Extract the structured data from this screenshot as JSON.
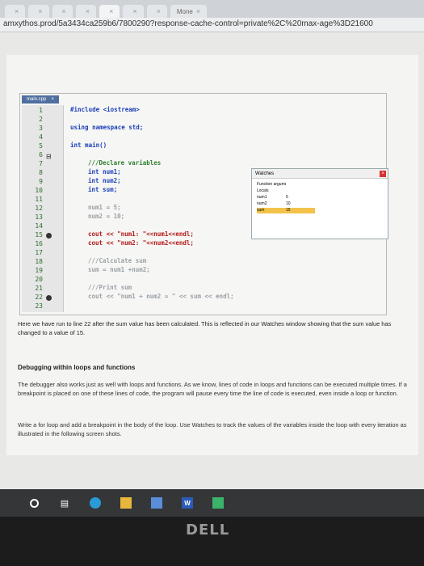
{
  "browser": {
    "tabs": [
      {
        "label": "",
        "active": false
      },
      {
        "label": "",
        "active": false
      },
      {
        "label": "",
        "active": false
      },
      {
        "label": "",
        "active": false
      },
      {
        "label": "",
        "active": true
      },
      {
        "label": "",
        "active": false
      },
      {
        "label": "",
        "active": false
      },
      {
        "label": "Mone",
        "active": false
      }
    ],
    "url": "amxythos.prod/5a3434ca259b6/7800290?response-cache-control=private%2C%20max-age%3D21600"
  },
  "ide": {
    "tab_label": "main.cpp",
    "lines": [
      "1",
      "2",
      "3",
      "4",
      "5",
      "6",
      "7",
      "8",
      "9",
      "10",
      "11",
      "12",
      "13",
      "14",
      "15",
      "16",
      "17",
      "18",
      "19",
      "20",
      "21",
      "22",
      "23"
    ],
    "code": {
      "l1": "#include <iostream>",
      "l3": "using namespace std;",
      "l5": "int main()",
      "l7": "///Declare variables",
      "l8": "int num1;",
      "l9": "int num2;",
      "l10": "int sum;",
      "l12": "num1 = 5;",
      "l13": "num2 = 10;",
      "l15": "cout << \"num1: \"<<num1<<endl;",
      "l16": "cout << \"num2: \"<<num2<<endl;",
      "l18": "///Calculate sum",
      "l19": "sum = num1 +num2;",
      "l21": "///Print sum",
      "l22": "cout << \"num1 + num2 = \" << sum << endl;"
    },
    "watches": {
      "title": "Watches",
      "rows": [
        {
          "name": "Function arguments",
          "value": ""
        },
        {
          "name": "Locals",
          "value": ""
        },
        {
          "name": "num1",
          "value": "5"
        },
        {
          "name": "num2",
          "value": "10"
        },
        {
          "name": "sum",
          "value": "15"
        }
      ]
    }
  },
  "content": {
    "caption": "Here we have run to line 22 after the sum value has been calculated. This is reflected in our Watches window showing that the sum value has changed to a value of 15.",
    "heading": "Debugging within loops and functions",
    "para1": "The debugger also works just as well with loops and functions. As we know, lines of code in loops and functions can be executed multiple times. If a breakpoint is placed on one of these lines of code, the program will pause every time the line of code is executed, even inside a loop or function.",
    "para2": "Write a for loop and add a breakpoint in the body of the loop. Use Watches to track the values of the variables inside the loop with every iteration as illustrated in the following screen shots."
  },
  "taskbar": {
    "items": [
      "cortana-icon",
      "task-view-icon",
      "chrome-icon",
      "explorer-icon",
      "store-icon",
      "word-icon",
      "app-icon"
    ],
    "word_label": "W"
  },
  "device": {
    "logo": "DELL"
  }
}
